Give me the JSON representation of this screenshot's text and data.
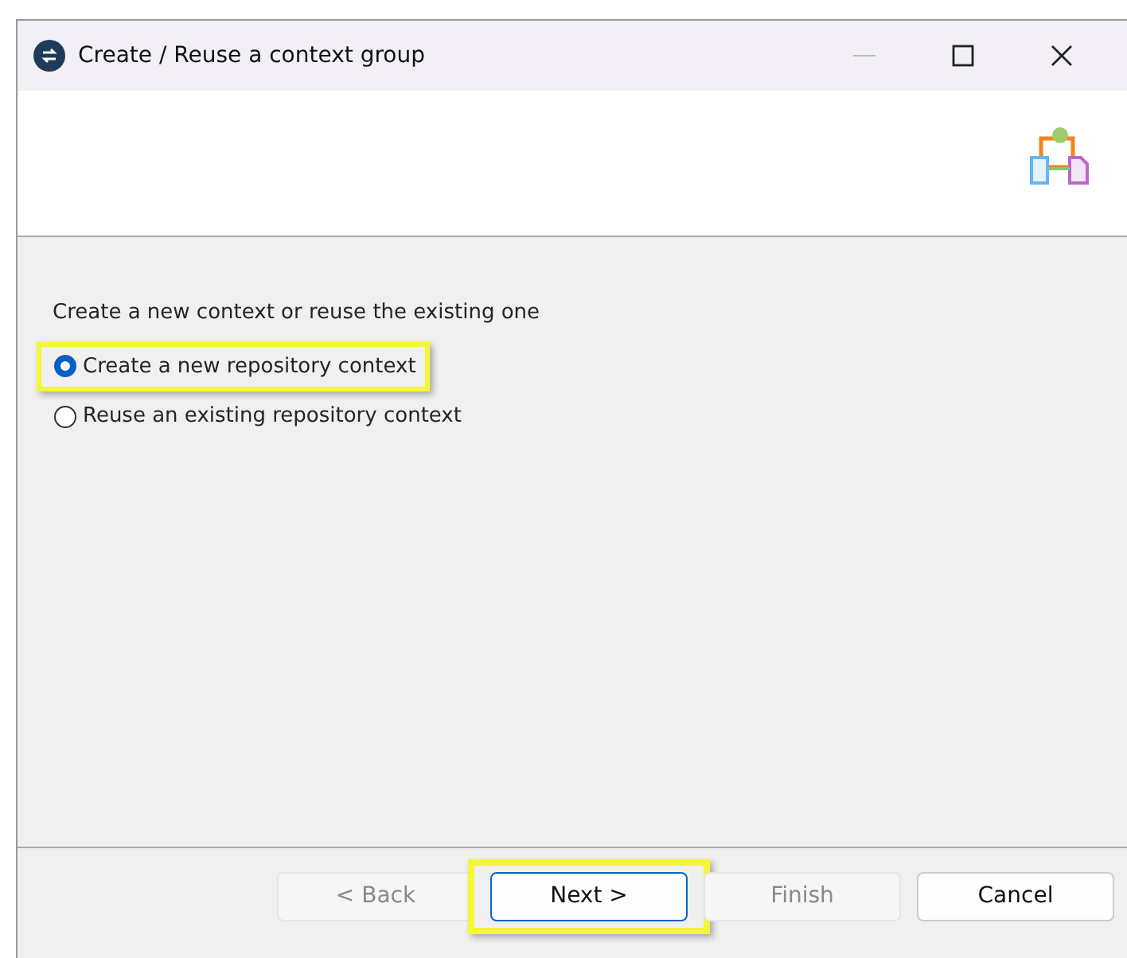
{
  "window": {
    "title": "Create / Reuse a context group"
  },
  "prompt": "Create a new context or reuse the existing one",
  "options": [
    {
      "label": "Create a new repository context",
      "selected": true,
      "highlighted": true
    },
    {
      "label": "Reuse an existing repository context",
      "selected": false,
      "highlighted": false
    }
  ],
  "buttons": [
    {
      "label": "< Back",
      "disabled": true,
      "default": false,
      "highlighted": false
    },
    {
      "label": "Next >",
      "disabled": false,
      "default": true,
      "highlighted": true
    },
    {
      "label": "Finish",
      "disabled": true,
      "default": false,
      "highlighted": false
    },
    {
      "label": "Cancel",
      "disabled": false,
      "default": false,
      "highlighted": false
    }
  ]
}
